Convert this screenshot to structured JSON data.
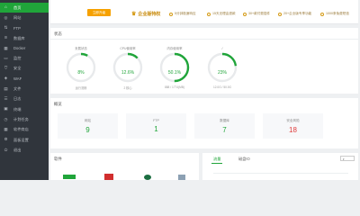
{
  "sidebar": {
    "items": [
      {
        "label": "首页",
        "icon": "home-icon",
        "glyph": "⌂",
        "active": true
      },
      {
        "label": "网站",
        "icon": "globe-icon",
        "glyph": "◎"
      },
      {
        "label": "FTP",
        "icon": "ftp-icon",
        "glyph": "⇅"
      },
      {
        "label": "数据库",
        "icon": "database-icon",
        "glyph": "≋"
      },
      {
        "label": "Docker",
        "icon": "docker-icon",
        "glyph": "▦"
      },
      {
        "label": "监控",
        "icon": "monitor-icon",
        "glyph": "▭"
      },
      {
        "label": "安全",
        "icon": "shield-icon",
        "glyph": "⛉"
      },
      {
        "label": "WAF",
        "icon": "waf-icon",
        "glyph": "◈"
      },
      {
        "label": "文件",
        "icon": "folder-icon",
        "glyph": "▤"
      },
      {
        "label": "日志",
        "icon": "log-icon",
        "glyph": "☰"
      },
      {
        "label": "终端",
        "icon": "terminal-icon",
        "glyph": "▣"
      },
      {
        "label": "计划任务",
        "icon": "clock-icon",
        "glyph": "◷"
      },
      {
        "label": "软件商店",
        "icon": "store-icon",
        "glyph": "▦"
      },
      {
        "label": "面板设置",
        "icon": "gear-icon",
        "glyph": "⚙"
      },
      {
        "label": "退出",
        "icon": "logout-icon",
        "glyph": "⏻"
      }
    ]
  },
  "topbar": {
    "badge": "立即升级",
    "ent_title": "企业版特权",
    "features": [
      "5分钟极速响应",
      "15天无理由退款",
      "30+款付费插件",
      "20+企业版专享功能",
      "1000条免费短信"
    ]
  },
  "status": {
    "title": "状态",
    "gauges": [
      {
        "label": "负载状态",
        "percent": 8,
        "percent_text": "8%",
        "sub": "运行流畅",
        "ring": "#20a53a"
      },
      {
        "label": "CPU使用率",
        "percent": 12.6,
        "percent_text": "12.6%",
        "sub": "2 核心",
        "ring": "#20a53a"
      },
      {
        "label": "内存使用率",
        "percent": 50.1,
        "percent_text": "50.1%",
        "sub": "888 / 1774(MB)",
        "ring": "#20a53a"
      },
      {
        "label": "/",
        "percent": 23,
        "percent_text": "23%",
        "sub": "12.0G / 50.0G",
        "ring": "#20a53a"
      }
    ]
  },
  "overview": {
    "title": "概览",
    "cards": [
      {
        "label": "网站",
        "value": "9",
        "color": "#20a53a"
      },
      {
        "label": "FTP",
        "value": "1",
        "color": "#20a53a"
      },
      {
        "label": "数据库",
        "value": "7",
        "color": "#20a53a"
      },
      {
        "label": "安全风险",
        "value": "18",
        "color": "#e03c3c"
      }
    ]
  },
  "software": {
    "title": "软件"
  },
  "traffic": {
    "tabs": [
      "流量",
      "磁盘IO"
    ]
  }
}
